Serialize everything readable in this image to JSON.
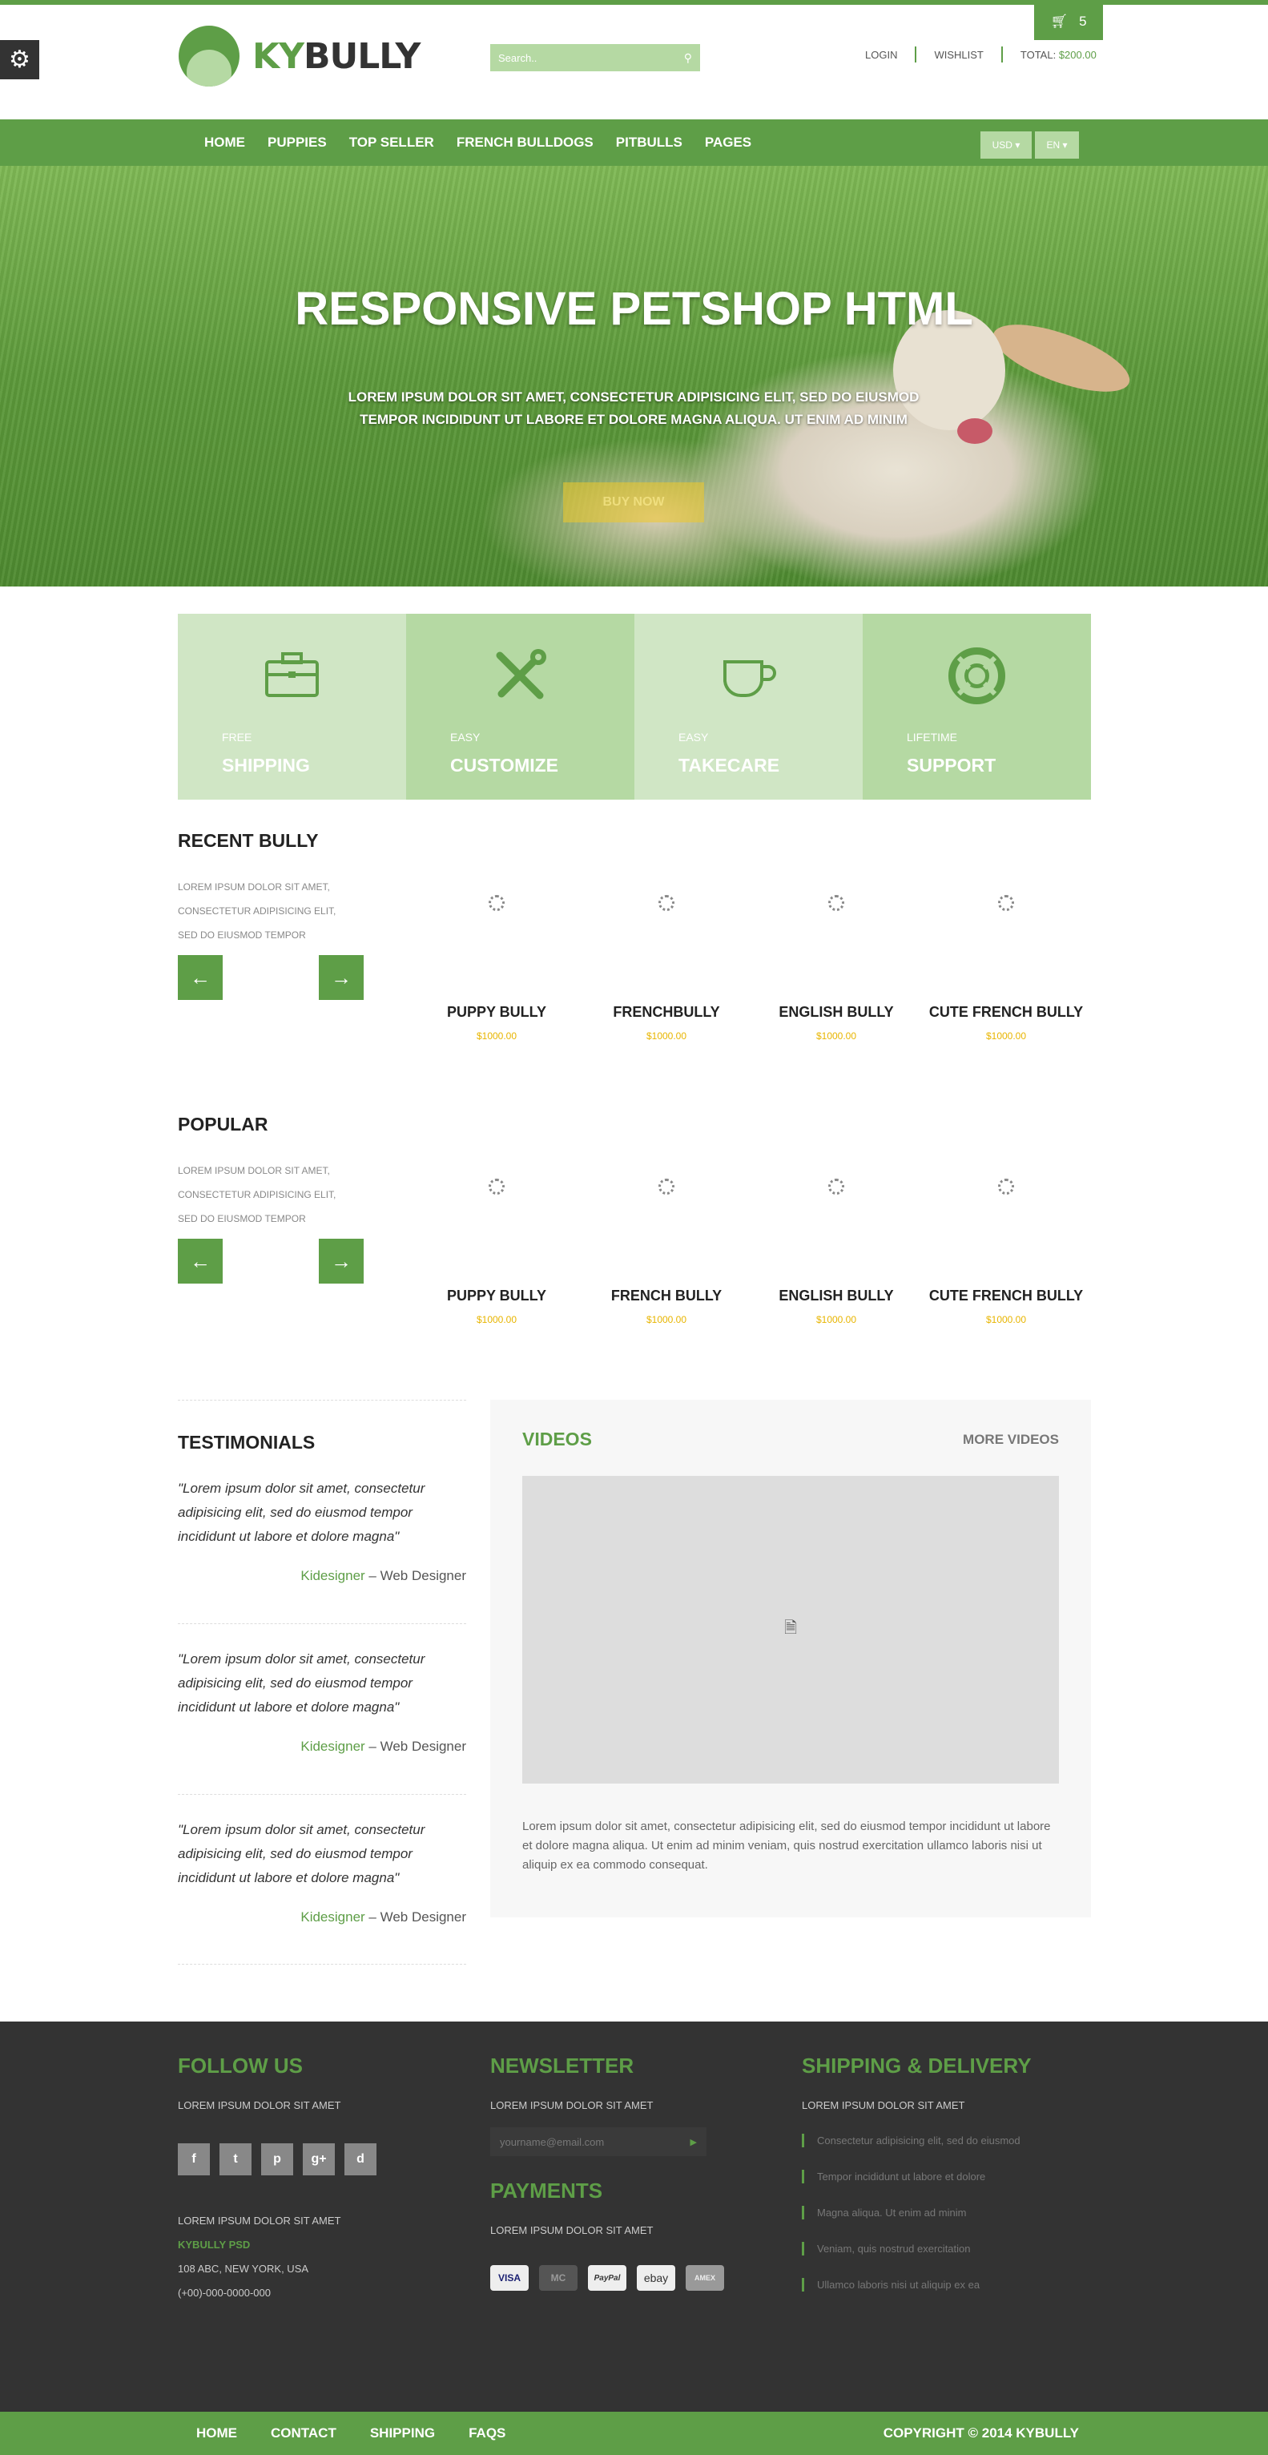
{
  "header": {
    "logo_prefix": "KY",
    "logo_suffix": "BULLY",
    "search_placeholder": "Search..",
    "search_icon": "search-icon",
    "cart_icon": "basket-icon",
    "cart_count": "5",
    "login": "LOGIN",
    "wishlist": "WISHLIST",
    "total_label": "TOTAL:",
    "total_value": "$200.00",
    "settings_icon": "gear-icon"
  },
  "nav": {
    "items": [
      "HOME",
      "PUPPIES",
      "TOP SELLER",
      "FRENCH BULLDOGS",
      "PITBULLS",
      "PAGES"
    ],
    "currency": "USD",
    "language": "EN"
  },
  "hero": {
    "title": "RESPONSIVE PETSHOP HTML",
    "subtitle_line1": "LOREM IPSUM DOLOR SIT AMET, CONSECTETUR ADIPISICING ELIT, SED DO EIUSMOD",
    "subtitle_line2": "TEMPOR INCIDIDUNT UT LABORE ET DOLORE MAGNA ALIQUA. UT ENIM AD MINIM",
    "button": "BUY NOW"
  },
  "features": [
    {
      "small": "FREE",
      "big": "SHIPPING",
      "icon": "briefcase-icon",
      "bg": "#d0e6c5",
      "icon_color": "#5e9e47"
    },
    {
      "small": "EASY",
      "big": "CUSTOMIZE",
      "icon": "tools-icon",
      "bg": "#b5d9a3",
      "icon_color": "#5e9e47"
    },
    {
      "small": "EASY",
      "big": "TAKECARE",
      "icon": "cup-icon",
      "bg": "#d0e6c5",
      "icon_color": "#5e9e47"
    },
    {
      "small": "LIFETIME",
      "big": "SUPPORT",
      "icon": "lifebuoy-icon",
      "bg": "#b5d9a3",
      "icon_color": "#5e9e47"
    }
  ],
  "recent": {
    "title": "RECENT BULLY",
    "desc_line1": "LOREM IPSUM DOLOR SIT AMET,",
    "desc_line2": "CONSECTETUR ADIPISICING ELIT,",
    "desc_line3": "SED DO EIUSMOD TEMPOR",
    "products": [
      {
        "name": "PUPPY BULLY",
        "price": "$1000.00"
      },
      {
        "name": "FRENCHBULLY",
        "price": "$1000.00"
      },
      {
        "name": "ENGLISH BULLY",
        "price": "$1000.00"
      },
      {
        "name": "CUTE FRENCH BULLY",
        "price": "$1000.00"
      }
    ]
  },
  "popular": {
    "title": "POPULAR",
    "desc_line1": "LOREM IPSUM DOLOR SIT AMET,",
    "desc_line2": "CONSECTETUR ADIPISICING ELIT,",
    "desc_line3": "SED DO EIUSMOD TEMPOR",
    "products": [
      {
        "name": "PUPPY BULLY",
        "price": "$1000.00"
      },
      {
        "name": "FRENCH BULLY",
        "price": "$1000.00"
      },
      {
        "name": "ENGLISH BULLY",
        "price": "$1000.00"
      },
      {
        "name": "CUTE FRENCH BULLY",
        "price": "$1000.00"
      }
    ]
  },
  "testimonials": {
    "title": "TESTIMONIALS",
    "items": [
      {
        "quote": "\"Lorem ipsum dolor sit amet, consectetur adipisicing elit, sed do eiusmod tempor incididunt ut labore et dolore magna\"",
        "name": "Kidesigner",
        "role": " – Web Designer"
      },
      {
        "quote": "\"Lorem ipsum dolor sit amet, consectetur adipisicing elit, sed do eiusmod tempor incididunt ut labore et dolore magna\"",
        "name": "Kidesigner",
        "role": " – Web Designer"
      },
      {
        "quote": "\"Lorem ipsum dolor sit amet, consectetur adipisicing elit, sed do eiusmod tempor incididunt ut labore et dolore magna\"",
        "name": "Kidesigner",
        "role": " – Web Designer"
      }
    ]
  },
  "videos": {
    "title": "VIDEOS",
    "more": "MORE VIDEOS",
    "text": "Lorem ipsum dolor sit amet, consectetur adipisicing elit, sed do eiusmod tempor incididunt ut labore et dolore magna aliqua. Ut enim ad minim veniam, quis nostrud exercitation ullamco laboris nisi ut aliquip ex ea commodo consequat."
  },
  "footer": {
    "follow_title": "FOLLOW US",
    "follow_text": "LOREM IPSUM DOLOR SIT AMET",
    "socials": [
      "f",
      "t",
      "p",
      "g+",
      "d"
    ],
    "address_line1": "LOREM IPSUM DOLOR SIT AMET",
    "address_company": "KYBULLY PSD",
    "address_line2": "108 ABC, NEW YORK, USA",
    "address_phone": "(+00)-000-0000-000",
    "newsletter_title": "NEWSLETTER",
    "newsletter_text": "LOREM IPSUM DOLOR SIT AMET",
    "newsletter_placeholder": "yourname@email.com",
    "payments_title": "PAYMENTS",
    "payments_text": "LOREM IPSUM DOLOR SIT AMET",
    "payments": [
      "VISA",
      "MC",
      "PayPal",
      "ebay",
      "AMEX"
    ],
    "shipping_title": "SHIPPING & DELIVERY",
    "shipping_text": "LOREM IPSUM DOLOR SIT AMET",
    "shipping_items": [
      "Consectetur adipisicing elit, sed do eiusmod",
      "Tempor incididunt ut labore et dolore",
      "Magna aliqua. Ut enim ad minim",
      "Veniam, quis nostrud exercitation",
      "Ullamco laboris nisi ut aliquip ex ea"
    ]
  },
  "bottom": {
    "links": [
      "HOME",
      "CONTACT",
      "SHIPPING",
      "FAQS"
    ],
    "copyright": "COPYRIGHT © 2014 KYBULLY"
  },
  "colors": {
    "brand_green": "#5e9e47",
    "light_green": "#b5d9a3",
    "footer_bg": "#333333",
    "price_gold": "#e8b500"
  }
}
